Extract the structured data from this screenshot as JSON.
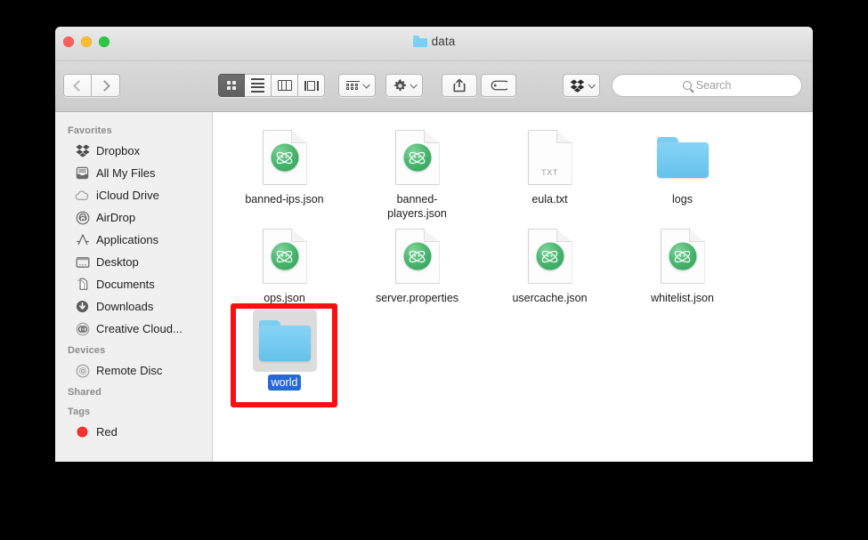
{
  "window": {
    "title": "data",
    "title_icon": "folder-icon",
    "traffic_lights": {
      "close_label": "close",
      "minimize_label": "minimize",
      "maximize_label": "maximize",
      "close_color": "#ff5f57",
      "minimize_color": "#ffbd2e",
      "maximize_color": "#28c940"
    }
  },
  "toolbar": {
    "back_label": "Back",
    "forward_label": "Forward",
    "views": [
      {
        "name": "icon-view",
        "label": "Icon View",
        "active": true
      },
      {
        "name": "list-view",
        "label": "List View",
        "active": false
      },
      {
        "name": "column-view",
        "label": "Column View",
        "active": false
      },
      {
        "name": "coverflow-view",
        "label": "Cover Flow View",
        "active": false
      }
    ],
    "arrange_label": "Arrange",
    "action_label": "Action",
    "share_label": "Share",
    "tags_label": "Edit Tags",
    "dropbox_label": "Dropbox"
  },
  "search": {
    "placeholder": "Search",
    "value": "",
    "icon": "search-icon"
  },
  "sidebar": {
    "sections": [
      {
        "header": "Favorites",
        "items": [
          {
            "label": "Dropbox",
            "icon": "dropbox-icon"
          },
          {
            "label": "All My Files",
            "icon": "all-my-files-icon"
          },
          {
            "label": "iCloud Drive",
            "icon": "icloud-icon"
          },
          {
            "label": "AirDrop",
            "icon": "airdrop-icon"
          },
          {
            "label": "Applications",
            "icon": "applications-icon"
          },
          {
            "label": "Desktop",
            "icon": "desktop-icon"
          },
          {
            "label": "Documents",
            "icon": "documents-icon"
          },
          {
            "label": "Downloads",
            "icon": "downloads-icon"
          },
          {
            "label": "Creative Cloud...",
            "icon": "creative-cloud-icon"
          }
        ]
      },
      {
        "header": "Devices",
        "items": [
          {
            "label": "Remote Disc",
            "icon": "disc-icon"
          }
        ]
      },
      {
        "header": "Shared",
        "items": []
      },
      {
        "header": "Tags",
        "items": [
          {
            "label": "Red",
            "icon": "red-tag-icon",
            "color": "#f5312e"
          }
        ]
      }
    ]
  },
  "content": {
    "files": [
      {
        "name": "banned-ips.json",
        "kind": "atom-file",
        "selected": false
      },
      {
        "name": "banned-players.json",
        "kind": "atom-file",
        "selected": false
      },
      {
        "name": "eula.txt",
        "kind": "text-file",
        "ext": "TXT",
        "selected": false
      },
      {
        "name": "logs",
        "kind": "folder",
        "selected": false
      },
      {
        "name": "ops.json",
        "kind": "atom-file",
        "selected": false
      },
      {
        "name": "server.properties",
        "kind": "atom-file",
        "selected": false
      },
      {
        "name": "usercache.json",
        "kind": "atom-file",
        "selected": false
      },
      {
        "name": "whitelist.json",
        "kind": "atom-file",
        "selected": false
      },
      {
        "name": "world",
        "kind": "folder",
        "selected": true
      }
    ]
  },
  "annotation": {
    "target": "world",
    "color": "#fa0f10"
  }
}
